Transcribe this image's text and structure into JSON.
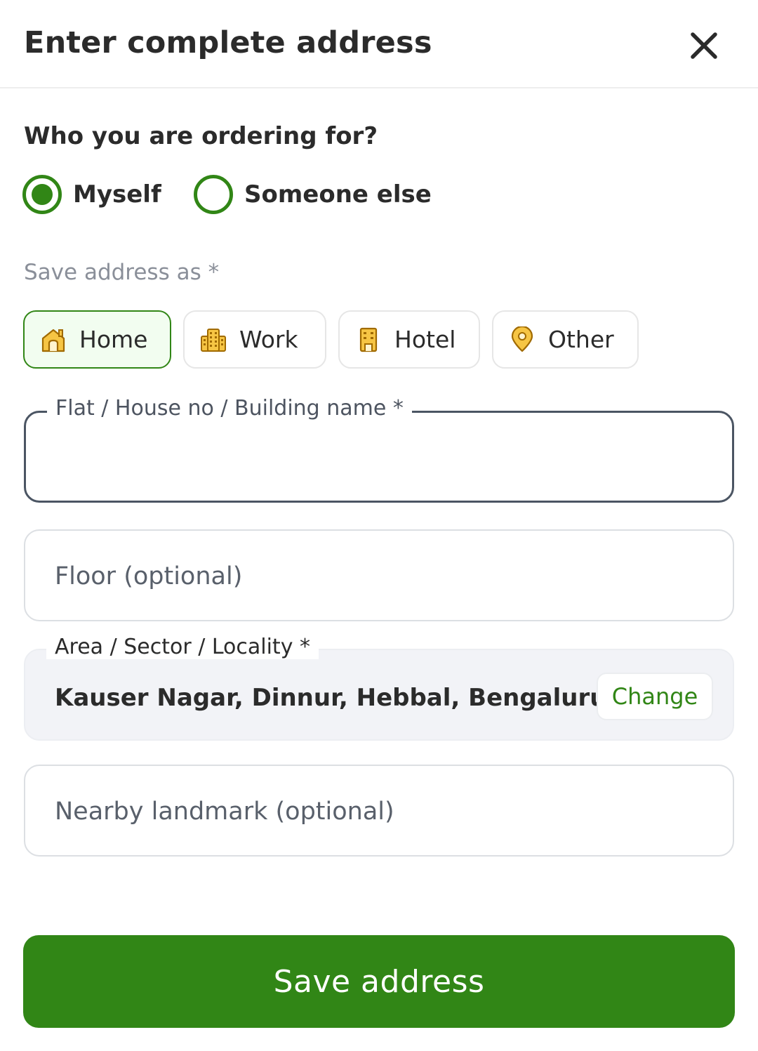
{
  "header": {
    "title": "Enter complete address",
    "close_icon": "close-icon"
  },
  "recipient": {
    "question": "Who you are ordering for?",
    "options": [
      {
        "label": "Myself",
        "selected": true
      },
      {
        "label": "Someone else",
        "selected": false
      }
    ]
  },
  "save_as": {
    "label": "Save address as *",
    "chips": [
      {
        "label": "Home",
        "icon": "home-icon",
        "selected": true
      },
      {
        "label": "Work",
        "icon": "office-building-icon",
        "selected": false
      },
      {
        "label": "Hotel",
        "icon": "hotel-icon",
        "selected": false
      },
      {
        "label": "Other",
        "icon": "location-pin-icon",
        "selected": false
      }
    ]
  },
  "fields": {
    "flat": {
      "label": "Flat / House no / Building name *",
      "value": ""
    },
    "floor": {
      "placeholder": "Floor (optional)",
      "value": ""
    },
    "area": {
      "label": "Area / Sector / Locality *",
      "value": "Kauser Nagar, Dinnur, Hebbal, Bengaluru",
      "change_label": "Change"
    },
    "landmark": {
      "placeholder": "Nearby landmark (optional)",
      "value": ""
    }
  },
  "footer": {
    "save_label": "Save address"
  },
  "colors": {
    "primary": "#318616",
    "chip_active_bg": "#f2fdf0",
    "icon_fill": "#f6c544",
    "icon_stroke": "#a06a00"
  }
}
